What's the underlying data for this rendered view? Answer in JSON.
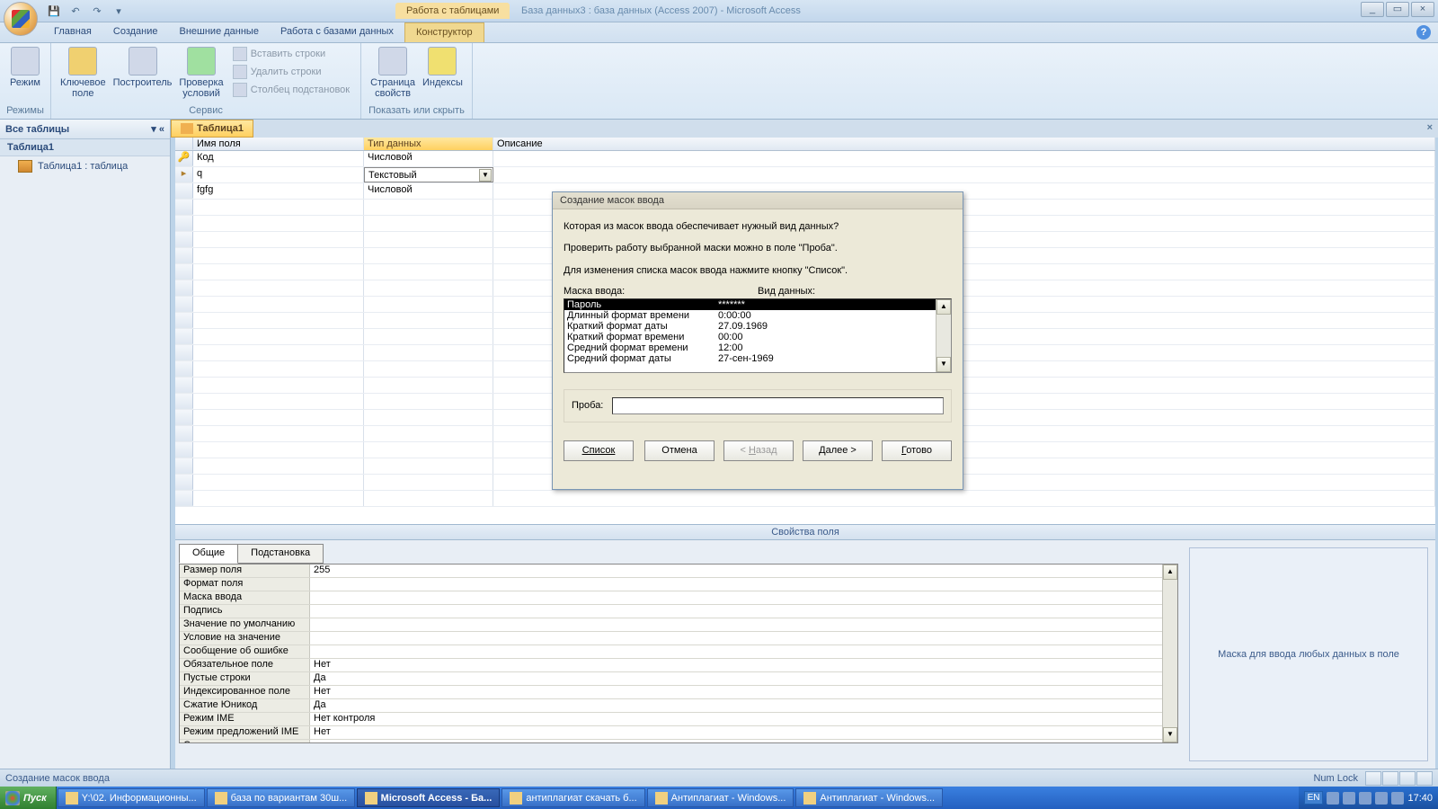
{
  "titlebar": {
    "context_tab": "Работа с таблицами",
    "title": "База данных3 : база данных (Access 2007) - Microsoft Access"
  },
  "ribbon_tabs": [
    "Главная",
    "Создание",
    "Внешние данные",
    "Работа с базами данных",
    "Конструктор"
  ],
  "ribbon": {
    "mode": "Режим",
    "modes_grp": "Режимы",
    "key_field": "Ключевое\nполе",
    "builder": "Построитель",
    "test_rules": "Проверка\nусловий",
    "insert_rows": "Вставить строки",
    "delete_rows": "Удалить строки",
    "lookup_col": "Столбец подстановок",
    "service_grp": "Сервис",
    "prop_sheet": "Страница\nсвойств",
    "indexes": "Индексы",
    "show_hide_grp": "Показать или скрыть"
  },
  "nav": {
    "header": "Все таблицы",
    "group": "Таблица1",
    "item": "Таблица1 : таблица"
  },
  "obj_tab": "Таблица1",
  "grid_headers": {
    "name": "Имя поля",
    "type": "Тип данных",
    "desc": "Описание"
  },
  "grid_rows": [
    {
      "name": "Код",
      "type": "Числовой",
      "pk": true
    },
    {
      "name": "q",
      "type": "Текстовый",
      "active": true
    },
    {
      "name": "fgfg",
      "type": "Числовой"
    }
  ],
  "fp_bar": "Свойства поля",
  "fp_tabs": [
    "Общие",
    "Подстановка"
  ],
  "fp_rows": [
    {
      "l": "Размер поля",
      "v": "255"
    },
    {
      "l": "Формат поля",
      "v": ""
    },
    {
      "l": "Маска ввода",
      "v": ""
    },
    {
      "l": "Подпись",
      "v": ""
    },
    {
      "l": "Значение по умолчанию",
      "v": ""
    },
    {
      "l": "Условие на значение",
      "v": ""
    },
    {
      "l": "Сообщение об ошибке",
      "v": ""
    },
    {
      "l": "Обязательное поле",
      "v": "Нет"
    },
    {
      "l": "Пустые строки",
      "v": "Да"
    },
    {
      "l": "Индексированное поле",
      "v": "Нет"
    },
    {
      "l": "Сжатие Юникод",
      "v": "Да"
    },
    {
      "l": "Режим IME",
      "v": "Нет контроля"
    },
    {
      "l": "Режим предложений IME",
      "v": "Нет"
    },
    {
      "l": "Смарт-теги",
      "v": ""
    }
  ],
  "fp_help": "Маска для ввода любых данных в поле",
  "wizard": {
    "title": "Создание масок ввода",
    "p1": "Которая из масок ввода обеспечивает нужный вид данных?",
    "p2": "Проверить работу выбранной маски можно в поле \"Проба\".",
    "p3": "Для изменения списка масок ввода нажмите кнопку \"Список\".",
    "col1": "Маска ввода:",
    "col2": "Вид данных:",
    "list": [
      {
        "m": "Пароль",
        "d": "*******",
        "sel": true
      },
      {
        "m": "Длинный формат времени",
        "d": "0:00:00"
      },
      {
        "m": "Краткий формат даты",
        "d": "27.09.1969"
      },
      {
        "m": "Краткий формат времени",
        "d": "00:00"
      },
      {
        "m": "Средний формат времени",
        "d": "12:00"
      },
      {
        "m": "Средний формат даты",
        "d": "27-сен-1969"
      }
    ],
    "proba": "Проба:",
    "btn_list": "Список",
    "btn_cancel": "Отмена",
    "btn_back": "< Назад",
    "btn_next": "Далее >",
    "btn_finish": "Готово"
  },
  "status": {
    "left": "Создание масок ввода",
    "numlock": "Num Lock"
  },
  "taskbar": {
    "start": "Пуск",
    "items": [
      "Y:\\02. Информационны...",
      "база по вариантам 30ш...",
      "Microsoft Access - Ба...",
      "антиплагиат скачать б...",
      "Антиплагиат - Windows...",
      "Антиплагиат - Windows..."
    ],
    "lang": "EN",
    "time": "17:40"
  }
}
